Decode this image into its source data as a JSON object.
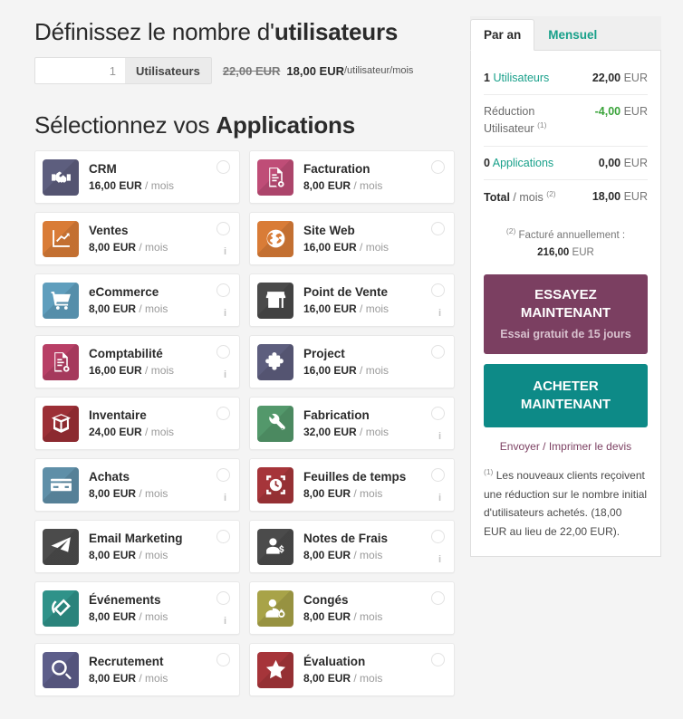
{
  "users_section": {
    "title_plain": "Définissez le nombre d'",
    "title_bold": "utilisateurs",
    "input_value": "1",
    "input_placeholder": "1",
    "addon_label": "Utilisateurs",
    "price_old": "22,00 EUR",
    "price_new": "18,00 EUR",
    "price_unit": "/utilisateur/mois"
  },
  "apps_section": {
    "title_plain": "Sélectionnez vos ",
    "title_bold": "Applications",
    "per_label": "/ mois",
    "apps": [
      {
        "name": "CRM",
        "price": "16,00 EUR",
        "color": "#5d5e7e",
        "icon": "handshake-icon",
        "info": false,
        "column": "left"
      },
      {
        "name": "Facturation",
        "price": "8,00 EUR",
        "color": "#bf4d77",
        "icon": "invoice-icon",
        "info": false,
        "column": "right"
      },
      {
        "name": "Ventes",
        "price": "8,00 EUR",
        "color": "#d97c37",
        "icon": "chart-up-icon",
        "info": true,
        "column": "left"
      },
      {
        "name": "Site Web",
        "price": "16,00 EUR",
        "color": "#d97c37",
        "icon": "globe-icon",
        "info": false,
        "column": "right"
      },
      {
        "name": "eCommerce",
        "price": "8,00 EUR",
        "color": "#5f9ebd",
        "icon": "cart-icon",
        "info": true,
        "column": "left"
      },
      {
        "name": "Point de Vente",
        "price": "16,00 EUR",
        "color": "#4a4a4a",
        "icon": "shop-icon",
        "info": true,
        "column": "right"
      },
      {
        "name": "Comptabilité",
        "price": "16,00 EUR",
        "color": "#b83f66",
        "icon": "invoice-icon",
        "info": true,
        "column": "left"
      },
      {
        "name": "Project",
        "price": "16,00 EUR",
        "color": "#5d5e7e",
        "icon": "puzzle-icon",
        "info": false,
        "column": "right"
      },
      {
        "name": "Inventaire",
        "price": "24,00 EUR",
        "color": "#9c2f36",
        "icon": "box-icon",
        "info": false,
        "column": "left"
      },
      {
        "name": "Fabrication",
        "price": "32,00 EUR",
        "color": "#53986b",
        "icon": "wrench-icon",
        "info": true,
        "column": "right"
      },
      {
        "name": "Achats",
        "price": "8,00 EUR",
        "color": "#5f8fa8",
        "icon": "credit-card-icon",
        "info": true,
        "column": "left"
      },
      {
        "name": "Feuilles de temps",
        "price": "8,00 EUR",
        "color": "#a6353a",
        "icon": "timer-icon",
        "info": true,
        "column": "right"
      },
      {
        "name": "Email Marketing",
        "price": "8,00 EUR",
        "color": "#4b4b4b",
        "icon": "paper-plane-icon",
        "info": false,
        "column": "left"
      },
      {
        "name": "Notes de Frais",
        "price": "8,00 EUR",
        "color": "#4b4b4b",
        "icon": "user-dollar-icon",
        "info": true,
        "column": "right"
      },
      {
        "name": "Événements",
        "price": "8,00 EUR",
        "color": "#2f9289",
        "icon": "ticket-icon",
        "info": true,
        "column": "left"
      },
      {
        "name": "Congés",
        "price": "8,00 EUR",
        "color": "#a8a348",
        "icon": "user-gear-icon",
        "info": false,
        "column": "right"
      },
      {
        "name": "Recrutement",
        "price": "8,00 EUR",
        "color": "#5d5e8a",
        "icon": "magnifier-icon",
        "info": false,
        "column": "left"
      },
      {
        "name": "Évaluation",
        "price": "8,00 EUR",
        "color": "#a6353a",
        "icon": "star-icon",
        "info": false,
        "column": "right"
      }
    ]
  },
  "summary_panel": {
    "tabs": [
      {
        "label": "Par an",
        "active": true
      },
      {
        "label": "Mensuel",
        "active": false
      }
    ],
    "rows": [
      {
        "left_count": "1",
        "left_label": "Utilisateurs",
        "left_sup": "",
        "amount": "22,00",
        "currency": "EUR",
        "style": "normal"
      },
      {
        "left_count": "",
        "left_label": "Réduction Utilisateur",
        "left_sup": "(1)",
        "amount": "-4,00",
        "currency": "EUR",
        "style": "discount"
      },
      {
        "left_count": "0",
        "left_label": "Applications",
        "left_sup": "",
        "amount": "0,00",
        "currency": "EUR",
        "style": "normal"
      },
      {
        "left_count": "",
        "left_label": "Total / mois",
        "left_sup": "(2)",
        "amount": "18,00",
        "currency": "EUR",
        "style": "total"
      }
    ],
    "annual_note_sup": "(2)",
    "annual_note_label": "Facturé annuellement :",
    "annual_note_amount": "216,00",
    "annual_note_currency": "EUR",
    "try_button_line1": "ESSAYEZ",
    "try_button_line2": "MAINTENANT",
    "try_button_sub": "Essai gratuit de 15 jours",
    "buy_button_line1": "ACHETER",
    "buy_button_line2": "MAINTENANT",
    "quote_link": "Envoyer / Imprimer le devis",
    "footnote_sup": "(1)",
    "footnote_text": "Les nouveaux clients reçoivent une réduction sur le nombre initial d'utilisateurs achetés. (18,00 EUR au lieu de 22,00 EUR)."
  },
  "colors": {
    "accent_teal": "#0d8a87",
    "accent_plum": "#7b3f61",
    "discount_green": "#3aa33a",
    "page_bg": "#f4f4f4"
  }
}
